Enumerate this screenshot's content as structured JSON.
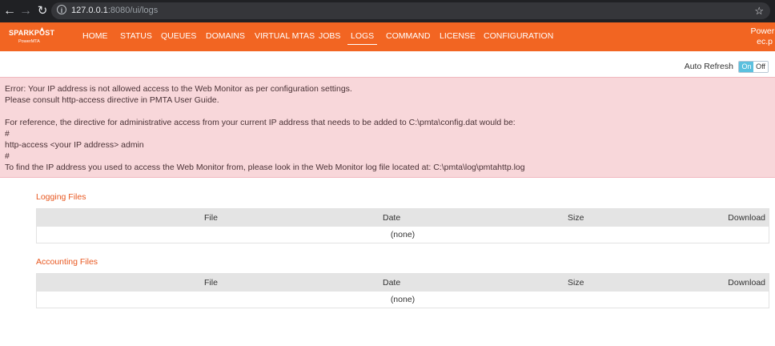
{
  "browser": {
    "url_host": "127.0.0.1",
    "url_rest": ":8080/ui/logs",
    "icons": {
      "back": "arrow-left-icon",
      "forward": "arrow-right-icon",
      "reload": "reload-icon",
      "info": "info-icon",
      "bookmark": "star-icon"
    }
  },
  "app": {
    "logo_text": "SPARKPOST",
    "logo_sub": "PowerMTA",
    "accent_color": "#f26522",
    "nav": [
      {
        "label": "HOME"
      },
      {
        "label": "STATUS"
      },
      {
        "label": "QUEUES"
      },
      {
        "label": "DOMAINS"
      },
      {
        "label": "VIRTUAL MTAS"
      },
      {
        "label": "JOBS"
      },
      {
        "label": "LOGS",
        "active": true
      },
      {
        "label": "COMMAND"
      },
      {
        "label": "LICENSE"
      },
      {
        "label": "CONFIGURATION"
      }
    ],
    "right_line1": "PowerM",
    "right_line2": "ec.p"
  },
  "auto_refresh": {
    "label": "Auto Refresh",
    "on_label": "On",
    "off_label": "Off",
    "state": "on"
  },
  "error": {
    "lines": [
      "Error: Your IP address is not allowed access to the Web Monitor as per configuration settings.",
      "Please consult http-access directive in PMTA User Guide.",
      "For reference, the directive for administrative access from your current IP address that needs to be added to C:\\pmta\\config.dat would be:",
      "#",
      "http-access <your IP address> admin",
      "#",
      "To find the IP address you used to access the Web Monitor from, please look in the Web Monitor log file located at: C:\\pmta\\log\\pmtahttp.log"
    ]
  },
  "logging": {
    "title": "Logging Files",
    "columns": [
      "File",
      "Date",
      "Size",
      "Download"
    ],
    "empty": "(none)"
  },
  "accounting": {
    "title": "Accounting Files",
    "columns": [
      "File",
      "Date",
      "Size",
      "Download"
    ],
    "empty": "(none)"
  }
}
